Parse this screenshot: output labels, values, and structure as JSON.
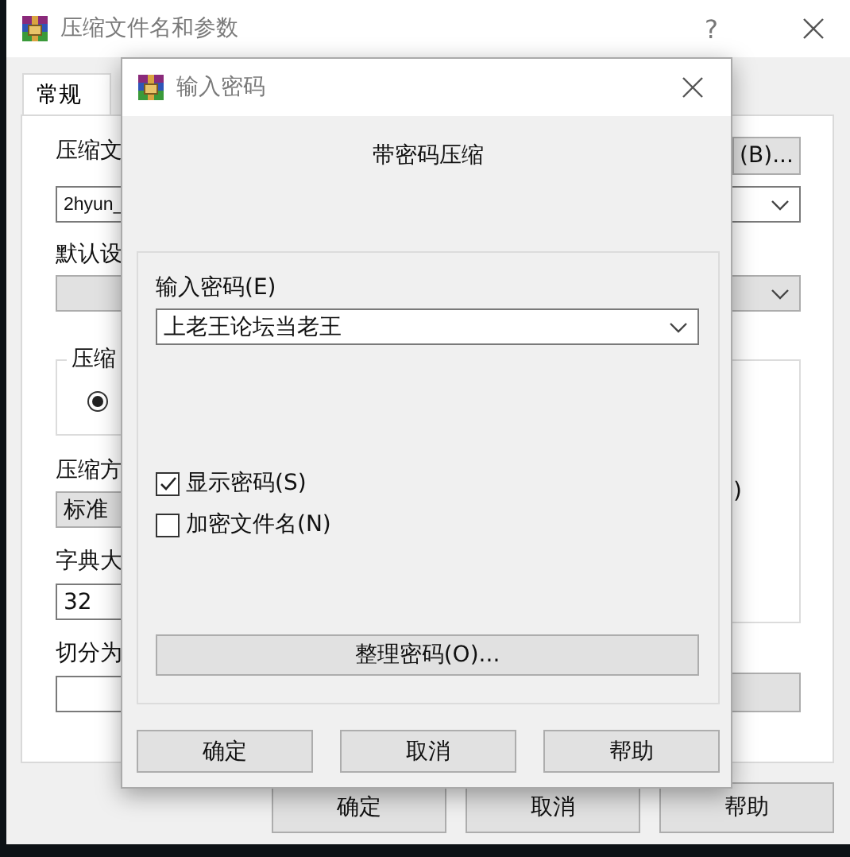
{
  "main_window": {
    "title": "压缩文件名和参数",
    "help_button": "?",
    "tabs": [
      {
        "label": "常规",
        "selected": true
      }
    ],
    "archive_name": {
      "label": "压缩文",
      "browse_button": "(B)...",
      "value": "2hyun_"
    },
    "profile": {
      "label": "默认设"
    },
    "format_group": {
      "label": "压缩",
      "options": [
        {
          "selected": true
        }
      ]
    },
    "method": {
      "label": "压缩方",
      "value": "标准"
    },
    "dictionary": {
      "label": "字典大",
      "value": "32"
    },
    "split": {
      "label": "切分为"
    },
    "options_group": {
      "text": ")"
    },
    "buttons": [
      "确定",
      "取消",
      "帮助"
    ]
  },
  "password_dialog": {
    "title": "输入密码",
    "heading": "带密码压缩",
    "password": {
      "label": "输入密码(E)",
      "value": "上老王论坛当老王"
    },
    "options": [
      {
        "label": "显示密码(S)",
        "checked": true
      },
      {
        "label": "加密文件名(N)",
        "checked": false
      }
    ],
    "organize_button": "整理密码(O)...",
    "buttons": [
      "确定",
      "取消",
      "帮助"
    ]
  }
}
